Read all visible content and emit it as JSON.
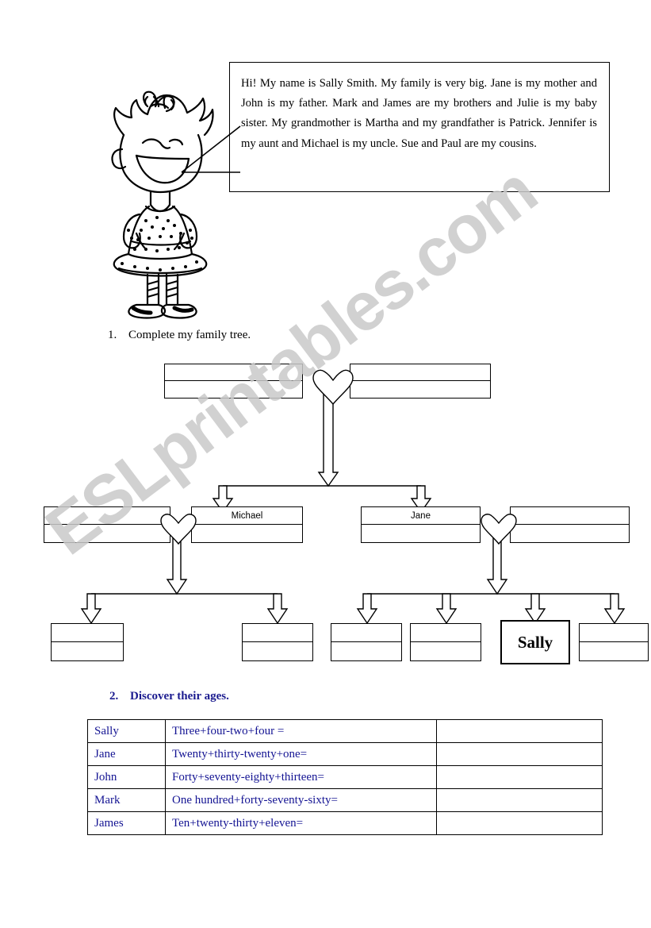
{
  "worksheet": {
    "watermark": "ESLprintables.com",
    "intro_text": "Hi! My name is Sally Smith. My family is very big. Jane is my mother and John is my father. Mark and James are my brothers and Julie is my baby sister. My grandmother is Martha and my grandfather is Patrick. Jennifer is my aunt and Michael is my uncle. Sue and Paul are my cousins.",
    "character_alt": "sally-smith-character"
  },
  "tasks": [
    {
      "number": "1.",
      "label": "Complete my family tree."
    },
    {
      "number": "2.",
      "label": "Discover their ages."
    }
  ],
  "family_tree": {
    "generation1": [
      {
        "id": "g1-left",
        "top": "",
        "bottom": ""
      },
      {
        "id": "g1-right",
        "top": "",
        "bottom": ""
      }
    ],
    "generation2": [
      {
        "id": "g2-1",
        "top": "",
        "bottom": ""
      },
      {
        "id": "g2-2",
        "top": "Michael",
        "bottom": ""
      },
      {
        "id": "g2-3",
        "top": "Jane",
        "bottom": ""
      },
      {
        "id": "g2-4",
        "top": "",
        "bottom": ""
      }
    ],
    "generation3": [
      {
        "id": "g3-1",
        "top": "",
        "bottom": ""
      },
      {
        "id": "g3-2",
        "top": "",
        "bottom": ""
      },
      {
        "id": "g3-3",
        "top": "",
        "bottom": ""
      },
      {
        "id": "g3-4",
        "top": "",
        "bottom": ""
      },
      {
        "id": "g3-5",
        "name": "Sally"
      },
      {
        "id": "g3-6",
        "top": "",
        "bottom": ""
      }
    ]
  },
  "ages_table": {
    "rows": [
      {
        "name": "Sally",
        "expression": "Three+four-two+four =",
        "answer": ""
      },
      {
        "name": "Jane",
        "expression": "Twenty+thirty-twenty+one=",
        "answer": ""
      },
      {
        "name": "John",
        "expression": "Forty+seventy-eighty+thirteen=",
        "answer": ""
      },
      {
        "name": "Mark",
        "expression": "One hundred+forty-seventy-sixty=",
        "answer": ""
      },
      {
        "name": "James",
        "expression": "Ten+twenty-thirty+eleven=",
        "answer": ""
      }
    ]
  },
  "colors": {
    "ink": "#000000",
    "navy": "#141493",
    "watermark": "#c9c9c9"
  }
}
